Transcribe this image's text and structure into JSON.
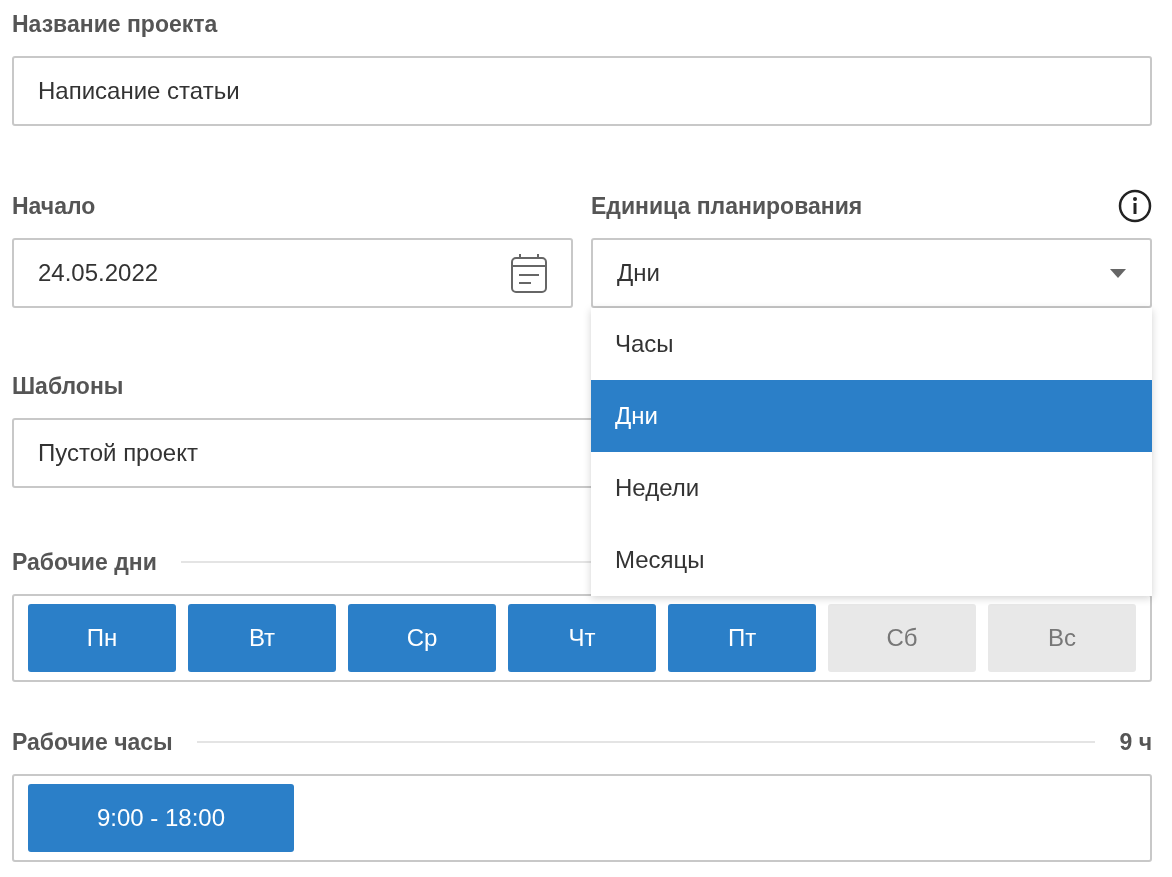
{
  "project_name": {
    "label": "Название проекта",
    "value": "Написание статьи"
  },
  "start": {
    "label": "Начало",
    "value": "24.05.2022"
  },
  "unit": {
    "label": "Единица планирования",
    "value": "Дни",
    "expanded": true,
    "options": [
      {
        "label": "Часы",
        "selected": false
      },
      {
        "label": "Дни",
        "selected": true
      },
      {
        "label": "Недели",
        "selected": false
      },
      {
        "label": "Месяцы",
        "selected": false
      }
    ]
  },
  "templates": {
    "label": "Шаблоны",
    "value": "Пустой проект"
  },
  "work_days": {
    "label": "Рабочие дни",
    "days": [
      {
        "label": "Пн",
        "selected": true
      },
      {
        "label": "Вт",
        "selected": true
      },
      {
        "label": "Ср",
        "selected": true
      },
      {
        "label": "Чт",
        "selected": true
      },
      {
        "label": "Пт",
        "selected": true
      },
      {
        "label": "Сб",
        "selected": false
      },
      {
        "label": "Вс",
        "selected": false
      }
    ]
  },
  "work_hours": {
    "label": "Рабочие часы",
    "total": "9 ч",
    "intervals": [
      "9:00 - 18:00"
    ]
  }
}
